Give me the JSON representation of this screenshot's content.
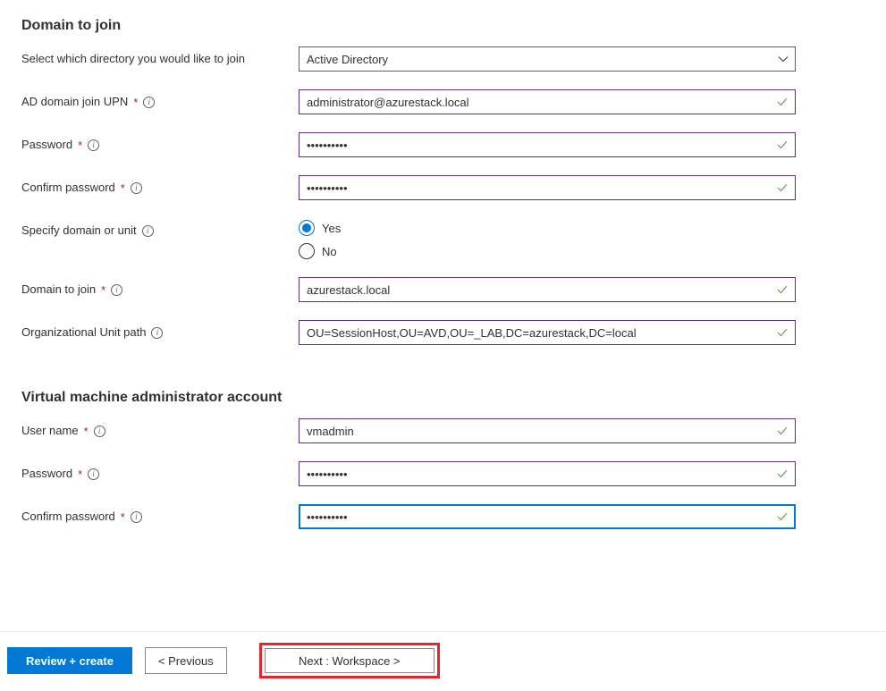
{
  "sections": {
    "domain": {
      "heading": "Domain to join",
      "directory": {
        "label": "Select which directory you would like to join",
        "value": "Active Directory"
      },
      "upn": {
        "label": "AD domain join UPN",
        "value": "administrator@azurestack.local"
      },
      "password": {
        "label": "Password",
        "value": "••••••••••"
      },
      "confirm_password": {
        "label": "Confirm password",
        "value": "••••••••••"
      },
      "specify_unit": {
        "label": "Specify domain or unit",
        "yes": "Yes",
        "no": "No"
      },
      "domain_to_join": {
        "label": "Domain to join",
        "value": "azurestack.local"
      },
      "ou_path": {
        "label": "Organizational Unit path",
        "value": "OU=SessionHost,OU=AVD,OU=_LAB,DC=azurestack,DC=local"
      }
    },
    "vm_admin": {
      "heading": "Virtual machine administrator account",
      "username": {
        "label": "User name",
        "value": "vmadmin"
      },
      "password": {
        "label": "Password",
        "value": "••••••••••"
      },
      "confirm_password": {
        "label": "Confirm password",
        "value": "••••••••••"
      }
    }
  },
  "footer": {
    "review_create": "Review + create",
    "previous": "< Previous",
    "next": "Next : Workspace >"
  }
}
